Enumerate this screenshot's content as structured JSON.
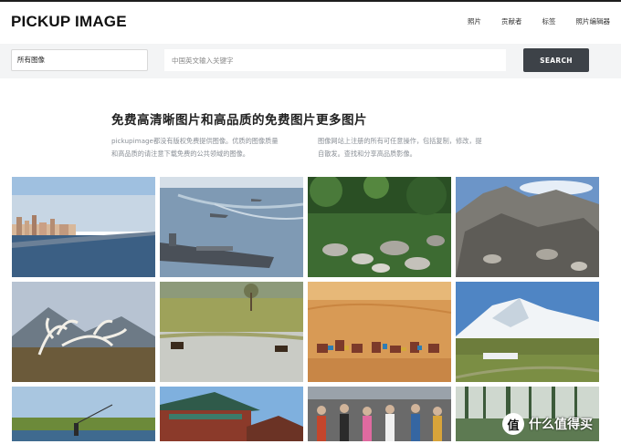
{
  "header": {
    "logo": "PICKUP IMAGE",
    "nav": [
      "照片",
      "贡献者",
      "标签",
      "照片编辑器"
    ]
  },
  "search": {
    "category_value": "所有图像",
    "placeholder": "中国英文输入关键字",
    "button_label": "SEARCH"
  },
  "intro": {
    "title": "免费高清晰图片和高品质的免费图片更多图片",
    "col1": "pickupimage都没有版权免费提供图像。优质的图像质量和高品质的请注意下载免费的公共领域的图像。",
    "col2": "图像网站上注册的所有可任意操作，包括复制，修改，提自散发。查找和分享高品质影像。"
  },
  "gallery": {
    "tiles": [
      {
        "subject": "city-waterfront"
      },
      {
        "subject": "aircraft-carrier"
      },
      {
        "subject": "rocky-forest-stream"
      },
      {
        "subject": "rocky-mountain"
      },
      {
        "subject": "antlers-mountain"
      },
      {
        "subject": "wetland-cattle"
      },
      {
        "subject": "desert-camels"
      },
      {
        "subject": "snow-mountain-valley"
      },
      {
        "subject": "river-reeds-fisherman"
      },
      {
        "subject": "temple-roof"
      },
      {
        "subject": "street-crowd"
      },
      {
        "subject": "forest-trees"
      }
    ]
  },
  "watermark": {
    "badge": "值",
    "text": "什么值得买"
  }
}
